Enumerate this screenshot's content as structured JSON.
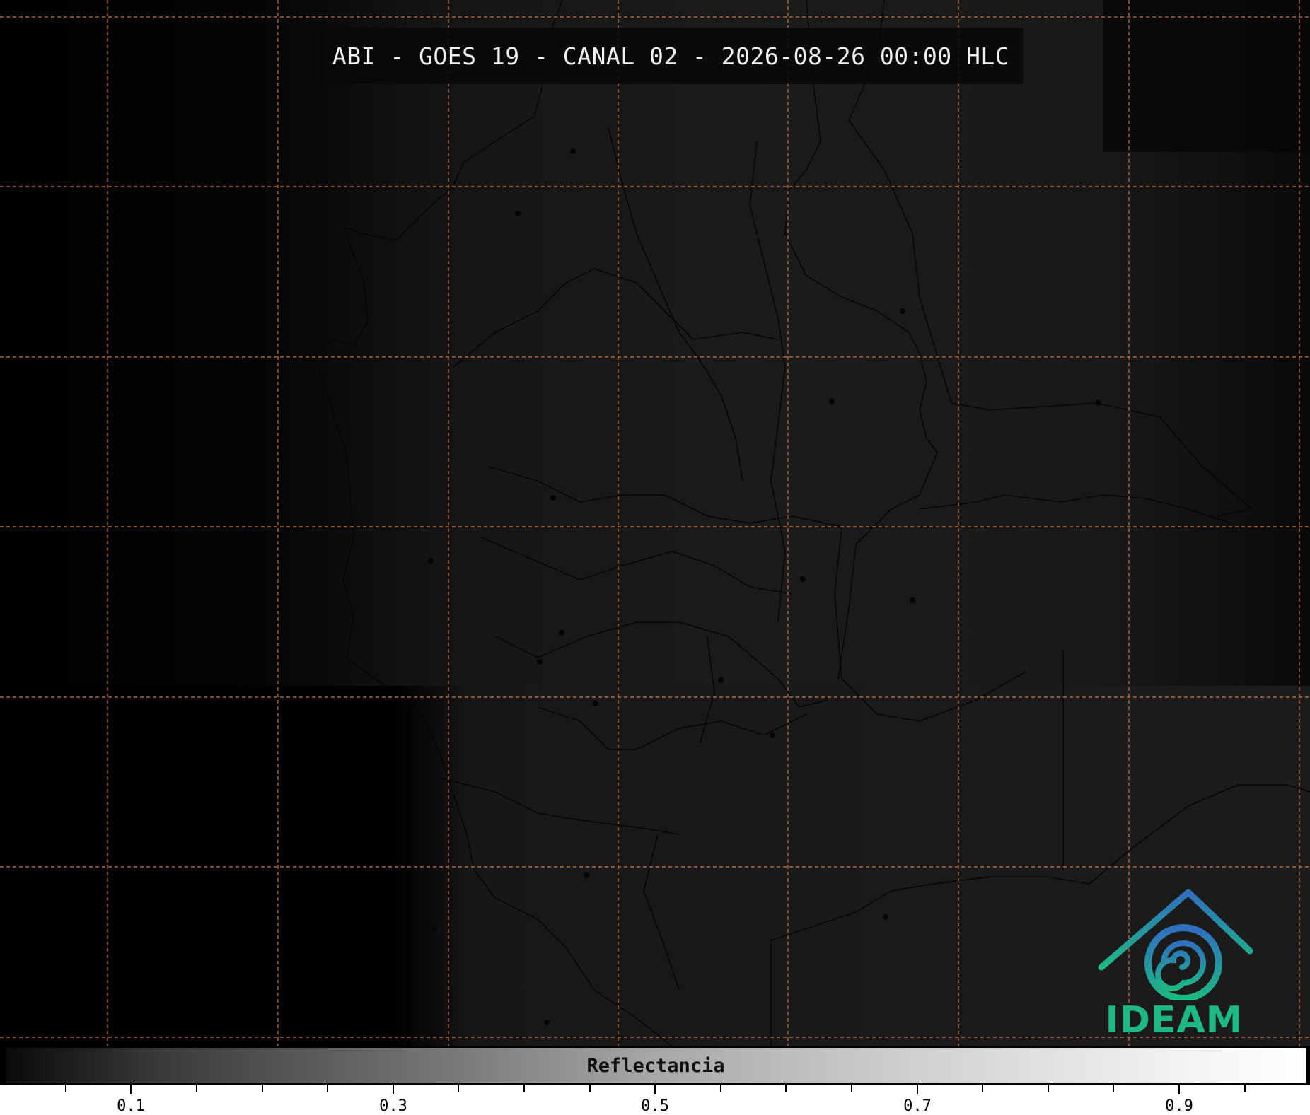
{
  "title": "ABI - GOES 19 - CANAL 02 - 2026-08-26 00:00 HLC",
  "colorbar": {
    "label": "Reflectancia",
    "range": [
      0.0,
      1.0
    ],
    "ticks": [
      "0.1",
      "0.3",
      "0.5",
      "0.7",
      "0.9"
    ],
    "gradient": [
      "#0a0a0a",
      "#ffffff"
    ]
  },
  "grid": {
    "color": "#d2773a",
    "style": "dashed"
  },
  "logo": {
    "text": "IDEAM",
    "color_top": "#2f6fc0",
    "color_bottom": "#1db884"
  }
}
